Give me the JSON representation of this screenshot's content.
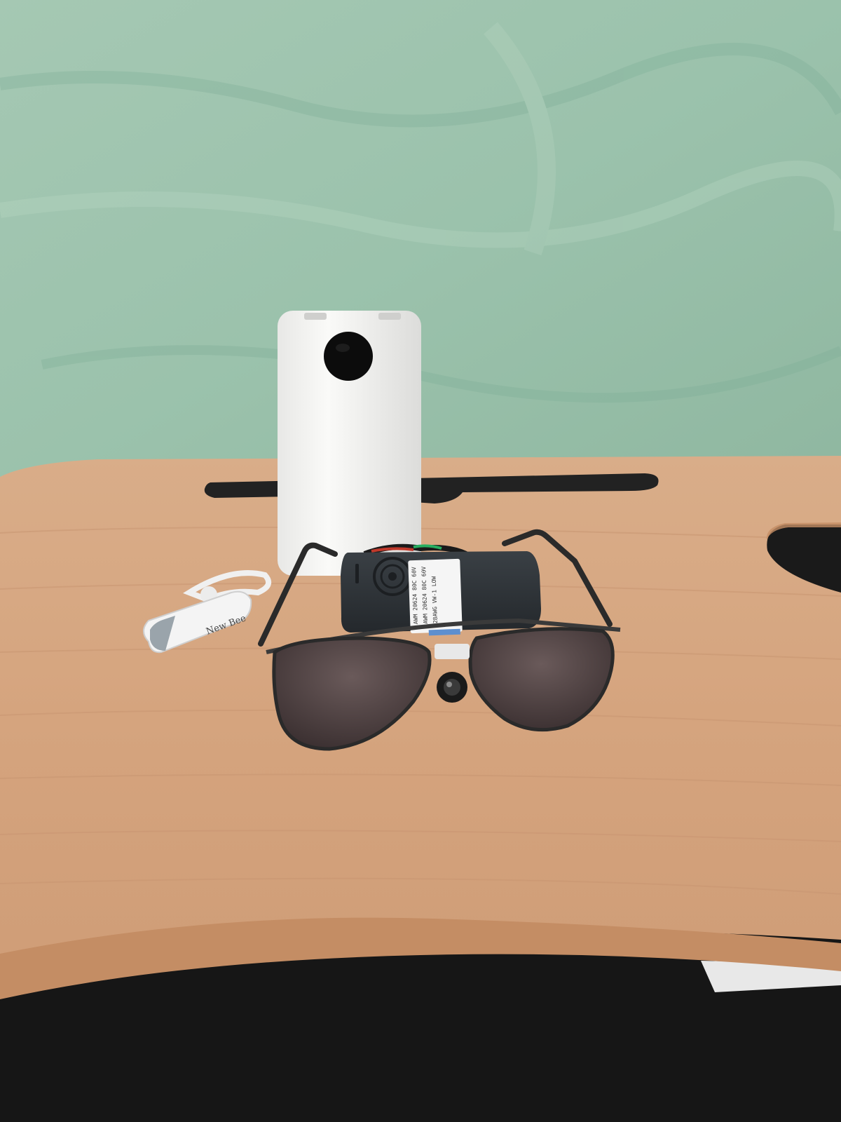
{
  "scene": {
    "colors": {
      "wall": "#9bc2ac",
      "wall_dark": "#7fae98",
      "desk_top": "#d9a984",
      "desk_edge": "#c48d64",
      "desk_grain": "#c99672",
      "floor": "#161616",
      "power_bank": "#f4f4f2",
      "display_circle": "#0c0c0c",
      "case": "#2c3136",
      "lens_tint": "#4a3e3e",
      "frame": "#2a2a2a",
      "headset": "#f2f2f2"
    },
    "objects": {
      "power_bank": {
        "description": "white power bank with round display"
      },
      "case": {
        "description": "dark grey electronics case with fan grille and label"
      },
      "sunglasses": {
        "description": "aviator sunglasses with mounted camera"
      },
      "headset": {
        "description": "white bluetooth earpiece",
        "brand": "New Bee"
      },
      "case_label": {
        "lines": [
          "AWM 20624 80C 60V",
          "AWM 20624 80C 60V",
          "28AWG VW-1 LOW"
        ]
      }
    }
  }
}
